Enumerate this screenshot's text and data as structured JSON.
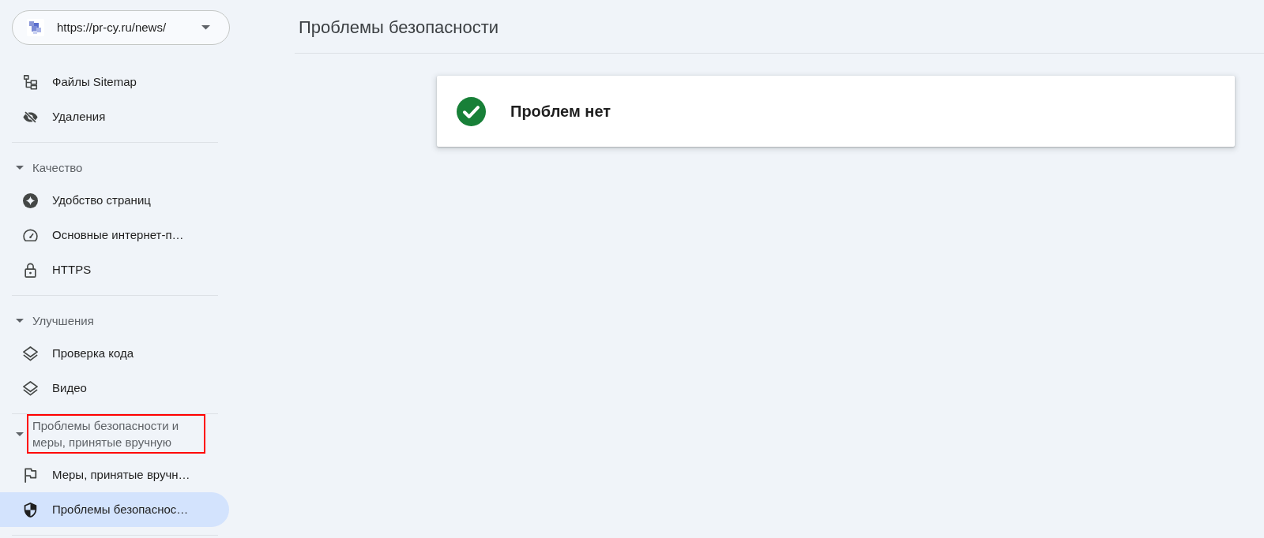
{
  "property_selector": {
    "url": "https://pr-cy.ru/news/"
  },
  "sidebar": {
    "groups": [
      {
        "items": [
          {
            "label": "Файлы Sitemap",
            "selected": false
          },
          {
            "label": "Удаления",
            "selected": false
          }
        ]
      },
      {
        "heading": "Качество",
        "expanded": true,
        "highlighted": false,
        "items": [
          {
            "label": "Удобство страниц",
            "selected": false
          },
          {
            "label": "Основные интернет-п…",
            "selected": false
          },
          {
            "label": "HTTPS",
            "selected": false
          }
        ]
      },
      {
        "heading": "Улучшения",
        "expanded": true,
        "highlighted": false,
        "items": [
          {
            "label": "Проверка кода",
            "selected": false
          },
          {
            "label": "Видео",
            "selected": false
          }
        ]
      },
      {
        "heading": "Проблемы безопасности и меры, принятые вручную",
        "expanded": true,
        "highlighted": true,
        "items": [
          {
            "label": "Меры, принятые вручн…",
            "selected": false
          },
          {
            "label": "Проблемы безопаснос…",
            "selected": true
          }
        ]
      }
    ]
  },
  "page_title": "Проблемы безопасности",
  "status_card": {
    "ok": true,
    "text": "Проблем нет"
  }
}
